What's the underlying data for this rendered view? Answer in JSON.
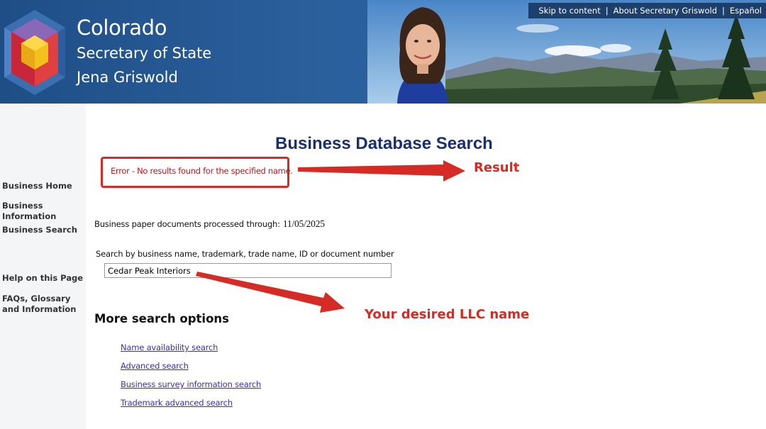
{
  "header": {
    "line1": "Colorado",
    "line2": "Secretary of State",
    "line3": "Jena Griswold",
    "utility_links": [
      "Skip to content",
      "About Secretary Griswold",
      "Español"
    ]
  },
  "nav": {
    "items": [
      "Business Home",
      "Business Information",
      "Business Search",
      "Help on this Page",
      "FAQs, Glossary and Information"
    ]
  },
  "main": {
    "title": "Business Database Search",
    "error": "Error - No results found for the specified name.",
    "processed_label": "Business paper documents processed through:",
    "processed_date": "11/05/2025",
    "search_label": "Search by business name, trademark, trade name, ID or document number",
    "search_value": "Cedar Peak Interiors",
    "more_title": "More search options",
    "links": [
      "Name availability search",
      "Advanced search",
      "Business survey information search",
      "Trademark advanced search"
    ]
  },
  "annotations": {
    "result": "Result",
    "llc": "Your desired LLC name",
    "color": "#d62b24"
  },
  "colors": {
    "header_blue": "#2a5f9c",
    "title_navy": "#1a2f6e",
    "link_purple": "#3b2fa8",
    "error_red": "#c0141a"
  }
}
